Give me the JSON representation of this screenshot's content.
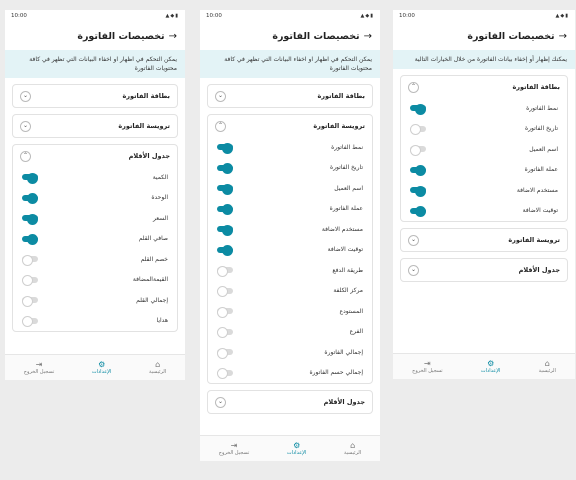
{
  "screens": [
    {
      "status_time": "10:00",
      "title": "تخصيصات الفاتورة",
      "notice": "يمكن التحكم في اظهار او اخفاء البيانات التي تظهر في كافة محتويات الفاتورة",
      "sections": [
        {
          "title": "بطاقة الفاتورة",
          "expanded": false,
          "rows": []
        },
        {
          "title": "ترويسة الفاتورة",
          "expanded": false,
          "rows": []
        },
        {
          "title": "جدول الأقلام",
          "expanded": true,
          "rows": [
            {
              "label": "الكمية",
              "on": true
            },
            {
              "label": "الوحدة",
              "on": true
            },
            {
              "label": "السعر",
              "on": true
            },
            {
              "label": "صافي القلم",
              "on": true
            },
            {
              "label": "خصم القلم",
              "on": false
            },
            {
              "label": "القيمةالمضافة",
              "on": false
            },
            {
              "label": "إجمالي القلم",
              "on": false
            },
            {
              "label": "هدايا",
              "on": false
            }
          ]
        }
      ],
      "nav": [
        {
          "label": "الرئيسية",
          "icon": "home-icon",
          "active": false
        },
        {
          "label": "الإعدادات",
          "icon": "gear-icon",
          "active": true
        },
        {
          "label": "تسجيل الخروج",
          "icon": "logout-icon",
          "active": false
        }
      ]
    },
    {
      "status_time": "10:00",
      "title": "تخصيصات الفاتورة",
      "notice": "يمكن التحكم في اظهار او اخفاء البيانات التي تظهر في كافة محتويات الفاتورة",
      "sections": [
        {
          "title": "بطاقة الفاتورة",
          "expanded": false,
          "rows": []
        },
        {
          "title": "ترويسة الفاتورة",
          "expanded": true,
          "rows": [
            {
              "label": "نمط الفاتورة",
              "on": true
            },
            {
              "label": "تاريخ الفاتورة",
              "on": true
            },
            {
              "label": "اسم العميل",
              "on": true
            },
            {
              "label": "عملة الفاتورة",
              "on": true
            },
            {
              "label": "مستخدم الاضافة",
              "on": true
            },
            {
              "label": "توقيت الاضافة",
              "on": true
            },
            {
              "label": "طريقة الدفع",
              "on": false
            },
            {
              "label": "مركز الكلفة",
              "on": false
            },
            {
              "label": "المستودع",
              "on": false
            },
            {
              "label": "الفرع",
              "on": false
            },
            {
              "label": "إجمالي الفاتورة",
              "on": false
            },
            {
              "label": "إجمالي حسم الفاتورة",
              "on": false
            }
          ]
        },
        {
          "title": "جدول الأقلام",
          "expanded": false,
          "rows": []
        }
      ],
      "nav": [
        {
          "label": "الرئيسية",
          "icon": "home-icon",
          "active": false
        },
        {
          "label": "الإعدادات",
          "icon": "gear-icon",
          "active": true
        },
        {
          "label": "تسجيل الخروج",
          "icon": "logout-icon",
          "active": false
        }
      ]
    },
    {
      "status_time": "10:00",
      "title": "تخصيصات الفاتورة",
      "notice": "يمكنك إظهار أو إخفاء بيانات الفاتورة من خلال الخيارات التالية",
      "sections": [
        {
          "title": "بطاقة الفاتورة",
          "expanded": true,
          "rows": [
            {
              "label": "نمط الفاتورة",
              "on": true
            },
            {
              "label": "تاريخ الفاتورة",
              "on": false
            },
            {
              "label": "اسم العميل",
              "on": false
            },
            {
              "label": "عملة الفاتورة",
              "on": true
            },
            {
              "label": "مستخدم الاضافة",
              "on": true
            },
            {
              "label": "توقيت الاضافة",
              "on": true
            }
          ]
        },
        {
          "title": "ترويسة الفاتورة",
          "expanded": false,
          "rows": []
        },
        {
          "title": "جدول الأقلام",
          "expanded": false,
          "rows": []
        }
      ],
      "nav": [
        {
          "label": "الرئيسية",
          "icon": "home-icon",
          "active": false
        },
        {
          "label": "الإعدادات",
          "icon": "gear-icon",
          "active": true
        },
        {
          "label": "تسجيل الخروج",
          "icon": "logout-icon",
          "active": false
        }
      ]
    }
  ],
  "colors": {
    "accent": "#0c8ba3",
    "notice_bg": "#e3f3f6",
    "toggle_off": "#dadada"
  }
}
